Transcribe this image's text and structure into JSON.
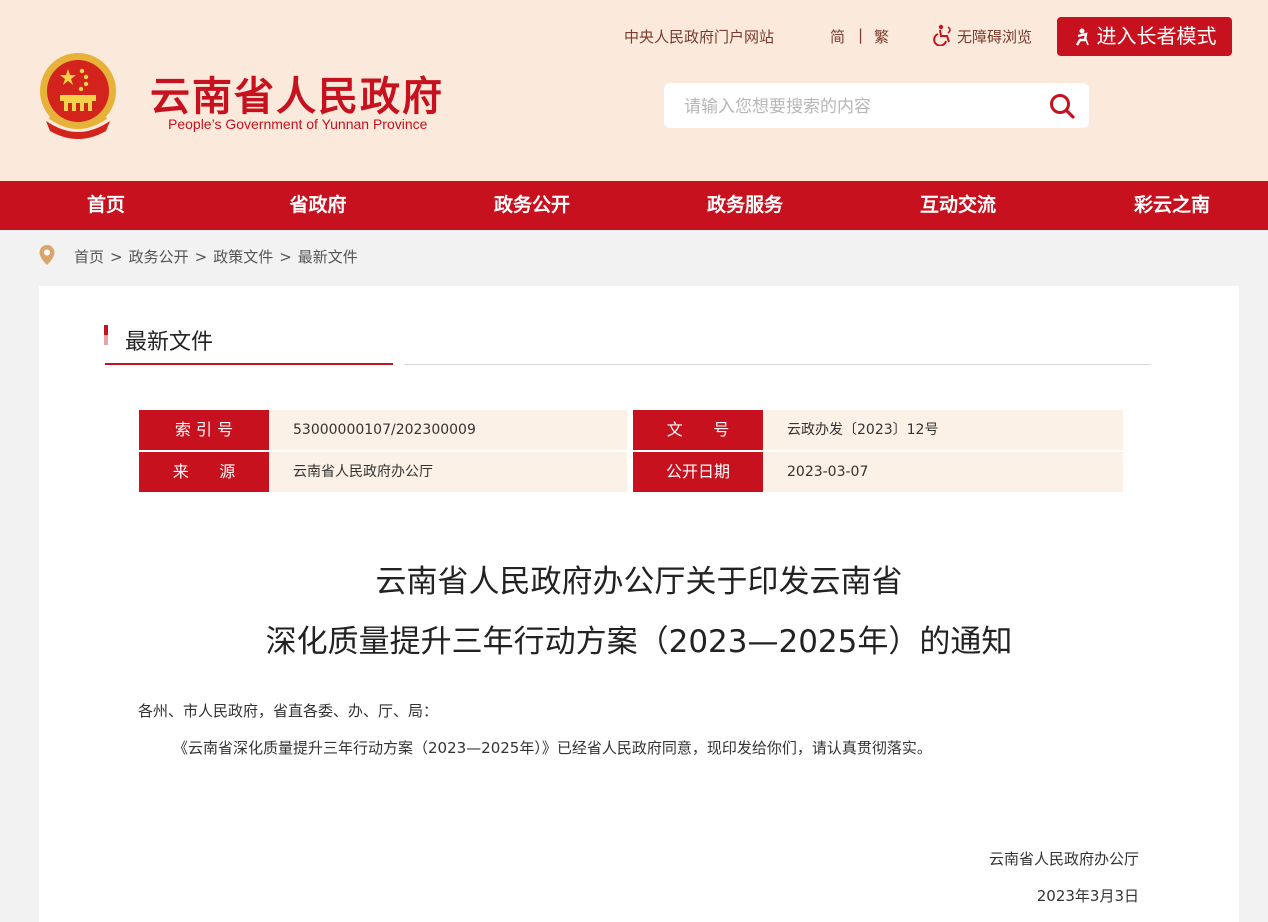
{
  "header": {
    "site_title": "云南省人民政府",
    "site_subtitle": "People’s Government of Yunnan Province",
    "links": {
      "central": "中央人民政府门户网站",
      "simplified": "简",
      "divider": "|",
      "traditional": "繁",
      "accessibility": "无障碍浏览",
      "elder_mode": "进入长者模式"
    },
    "search": {
      "placeholder": "请输入您想要搜索的内容"
    },
    "colors": {
      "brand_red": "#c8111e",
      "header_bg": "#fbeadb"
    }
  },
  "nav": {
    "items": [
      {
        "label": "首页"
      },
      {
        "label": "省政府"
      },
      {
        "label": "政务公开"
      },
      {
        "label": "政务服务"
      },
      {
        "label": "互动交流"
      },
      {
        "label": "彩云之南"
      }
    ]
  },
  "breadcrumb": {
    "items": [
      "首页",
      "政务公开",
      "政策文件",
      "最新文件"
    ],
    "separator": ">"
  },
  "section": {
    "title": "最新文件"
  },
  "meta": {
    "index_label": "索 引 号",
    "index_value": "53000000107/202300009",
    "docno_label": "文      号",
    "docno_value": "云政办发〔2023〕12号",
    "source_label": "来      源",
    "source_value": "云南省人民政府办公厅",
    "date_label": "公开日期",
    "date_value": "2023-03-07"
  },
  "document": {
    "title_line1": "云南省人民政府办公厅关于印发云南省",
    "title_line2": "深化质量提升三年行动方案（2023—2025年）的通知",
    "salutation": "各州、市人民政府，省直各委、办、厅、局：",
    "paragraph": "《云南省深化质量提升三年行动方案（2023—2025年）》已经省人民政府同意，现印发给你们，请认真贯彻落实。",
    "signer": "云南省人民政府办公厅",
    "sign_date": "2023年3月3日"
  }
}
